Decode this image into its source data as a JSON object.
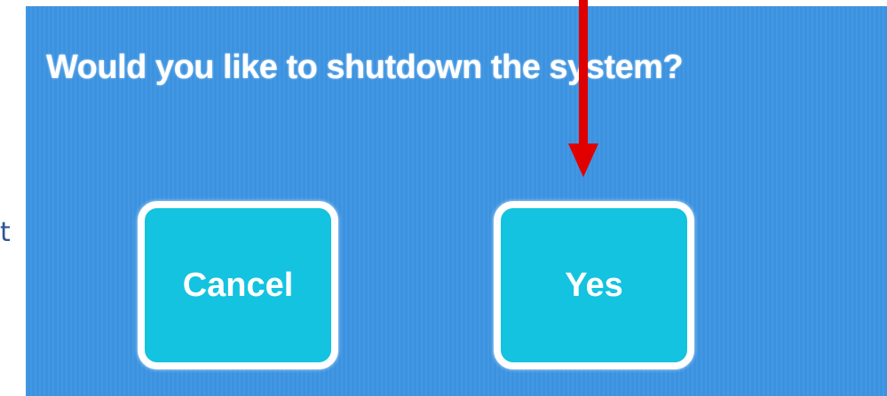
{
  "side_text": "t",
  "dialog": {
    "question": "Would you like to shutdown the system?",
    "cancel_label": "Cancel",
    "yes_label": "Yes"
  },
  "colors": {
    "screen_background": "#3d95e3",
    "button_fill": "#13c3df",
    "button_border": "#ffffff",
    "arrow": "#e00000"
  },
  "annotation": {
    "arrow_icon": "down-arrow-icon"
  }
}
